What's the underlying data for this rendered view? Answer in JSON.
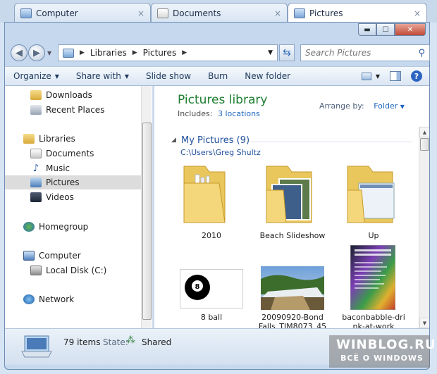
{
  "tabs": [
    {
      "label": "Computer",
      "close": "×"
    },
    {
      "label": "Documents",
      "close": "×"
    },
    {
      "label": "Pictures",
      "close": "×"
    }
  ],
  "window_buttons": {
    "minimize": "▬",
    "maximize": "☐",
    "close": "✕"
  },
  "nav": {
    "breadcrumb": [
      "Libraries",
      "Pictures"
    ],
    "search_placeholder": "Search Pictures"
  },
  "toolbar": {
    "organize": "Organize",
    "share_with": "Share with",
    "slide_show": "Slide show",
    "burn": "Burn",
    "new_folder": "New folder",
    "help": "?"
  },
  "sidebar": {
    "items": [
      {
        "label": "Downloads",
        "icon": "downloads-folder-icon"
      },
      {
        "label": "Recent Places",
        "icon": "recent-places-icon"
      },
      {
        "label": "Libraries",
        "icon": "libraries-icon"
      },
      {
        "label": "Documents",
        "icon": "documents-icon"
      },
      {
        "label": "Music",
        "icon": "music-icon"
      },
      {
        "label": "Pictures",
        "icon": "pictures-icon"
      },
      {
        "label": "Videos",
        "icon": "videos-icon"
      },
      {
        "label": "Homegroup",
        "icon": "homegroup-icon"
      },
      {
        "label": "Computer",
        "icon": "computer-icon"
      },
      {
        "label": "Local Disk (C:)",
        "icon": "local-disk-icon"
      },
      {
        "label": "Network",
        "icon": "network-icon"
      }
    ]
  },
  "main": {
    "title": "Pictures library",
    "includes_label": "Includes:",
    "includes_link": "3 locations",
    "arrange_label": "Arrange by:",
    "arrange_value": "Folder",
    "group_title": "My Pictures (9)",
    "group_path": "C:\\Users\\Greg Shultz",
    "files": [
      {
        "name": "2010",
        "kind": "folder"
      },
      {
        "name": "Beach Slideshow",
        "kind": "folder"
      },
      {
        "name": "Up",
        "kind": "folder"
      },
      {
        "name": "8 ball",
        "kind": "image"
      },
      {
        "name": "20090920-Bond Falls_TIM8073_45",
        "kind": "image"
      },
      {
        "name": "baconbabble-drink-at-work",
        "kind": "image"
      }
    ],
    "file_labels": {
      "f3": [
        "8 ball"
      ],
      "f4": [
        "20090920-Bond",
        "Falls_TIM8073_45"
      ],
      "f5": [
        "baconbabble-dri",
        "nk-at-work"
      ]
    }
  },
  "status": {
    "items_count": "79 items",
    "state_label": "State:",
    "state_value": "Shared"
  },
  "watermark": {
    "line1": "WINBLOG.RU",
    "line2": "ВСЁ О WINDOWS"
  }
}
